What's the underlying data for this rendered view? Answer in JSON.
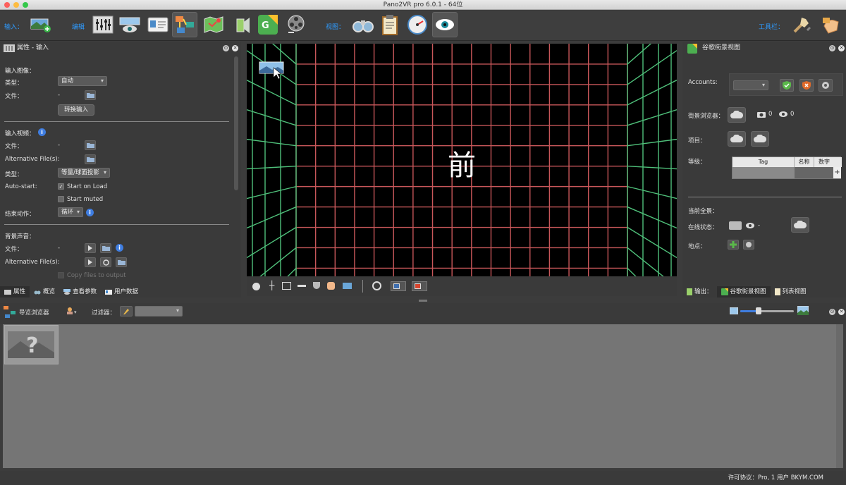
{
  "window": {
    "title": "Pano2VR pro 6.0.1 - 64位"
  },
  "toolbar": {
    "input_label": "输入：",
    "edit_label": "编辑",
    "view_label": "视图：",
    "toolbars_label": "工具栏："
  },
  "left_panel": {
    "header": "属性 - 输入",
    "input_image": {
      "section": "输入图像：",
      "type_label": "类型：",
      "type_value": "自动",
      "file_label": "文件：",
      "file_value": "-",
      "convert_button": "转换输入"
    },
    "input_video": {
      "section": "输入视频：",
      "file_label": "文件：",
      "file_value": "-",
      "alt_label": "Alternative File(s):",
      "type_label": "类型：",
      "type_value": "等量/球面投影",
      "autostart_label": "Auto-start:",
      "start_on_load": "Start on Load",
      "start_muted": "Start muted",
      "end_action_label": "结束动作：",
      "end_action_value": "循环"
    },
    "bg_sound": {
      "section": "背景声音：",
      "file_label": "文件：",
      "file_value": "-",
      "alt_label": "Alternative File(s):",
      "copy_label": "Copy files to output"
    },
    "tabs": [
      "属性",
      "概览",
      "查看参数",
      "用户数据"
    ]
  },
  "viewer": {
    "face_label": "前",
    "colors": {
      "wall": "#c8575a",
      "floor": "#4fc07a"
    }
  },
  "right_panel": {
    "header": "谷歌街景视图",
    "accounts_label": "Accounts:",
    "street_browser_label": "街景浏览器：",
    "camera_count": "0",
    "view_count": "0",
    "project_label": "项目：",
    "level_label": "等级：",
    "level_table_headers": [
      "Tag",
      "名称",
      "数字"
    ],
    "current_pano_label": "当前全景：",
    "online_status_label": "在线状态：",
    "online_value": "-",
    "location_label": "地点：",
    "tabs": [
      "输出：",
      "谷歌街景视图",
      "列表视图"
    ]
  },
  "browser": {
    "title": "导览浏览器",
    "filter_label": "过滤器："
  },
  "status": {
    "license": "许可协议：Pro, 1 用户 BKYM.COM"
  }
}
